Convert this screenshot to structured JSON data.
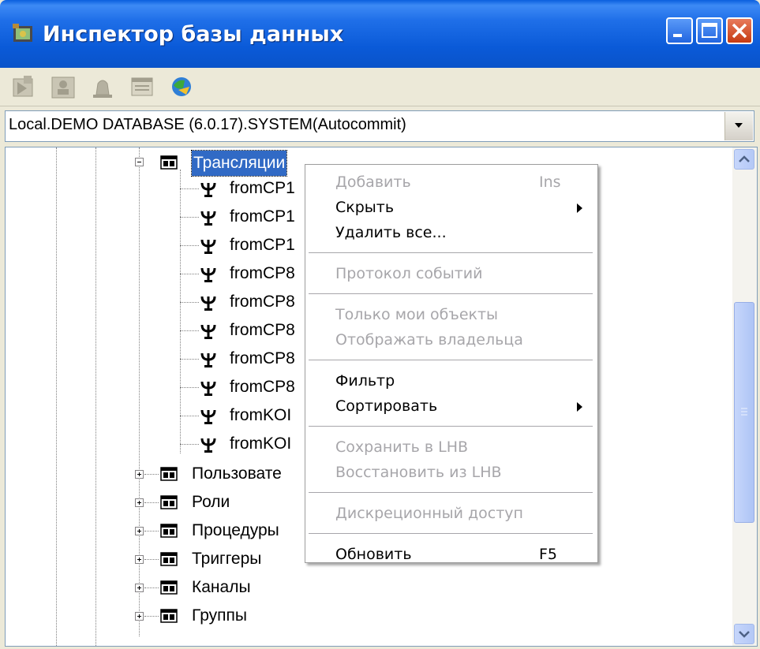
{
  "window": {
    "title": "Инспектор базы данных",
    "icon": "db-inspector-app-icon",
    "colors": {
      "titlebar": "#0a5ad8",
      "selection": "#316ac5",
      "disabled_text": "#a7a6aa"
    }
  },
  "toolbar": {
    "buttons": [
      {
        "icon": "new-object-icon"
      },
      {
        "icon": "user-properties-icon"
      },
      {
        "icon": "bell-icon"
      },
      {
        "icon": "window-list-icon"
      },
      {
        "icon": "refresh-globe-icon"
      }
    ]
  },
  "connection": {
    "selected": "Local.DEMO DATABASE (6.0.17).SYSTEM(Autocommit)"
  },
  "tree": {
    "parent": {
      "label": "Трансляции",
      "expanded": true
    },
    "children": [
      "fromCP1",
      "fromCP1",
      "fromCP1",
      "fromCP8",
      "fromCP8",
      "fromCP8",
      "fromCP8",
      "fromCP8",
      "fromKOI",
      "fromKOI"
    ],
    "siblings": [
      "Пользовате",
      "Роли",
      "Процедуры",
      "Триггеры",
      "Каналы",
      "Группы"
    ]
  },
  "context_menu": {
    "items": [
      {
        "label": "Добавить",
        "shortcut": "Ins",
        "disabled": true
      },
      {
        "label": "Скрыть",
        "submenu": true,
        "disabled": false
      },
      {
        "label": "Удалить все...",
        "disabled": false
      },
      {
        "separator": true
      },
      {
        "label": "Протокол событий",
        "disabled": true
      },
      {
        "separator": true
      },
      {
        "label": "Только мои объекты",
        "disabled": true
      },
      {
        "label": "Отображать владельца",
        "disabled": true
      },
      {
        "separator": true
      },
      {
        "label": "Фильтр",
        "disabled": false
      },
      {
        "label": "Сортировать",
        "submenu": true,
        "disabled": false
      },
      {
        "separator": true
      },
      {
        "label": "Сохранить в LHB",
        "disabled": true
      },
      {
        "label": "Восстановить из LHB",
        "disabled": true
      },
      {
        "separator": true
      },
      {
        "label": "Дискреционный доступ",
        "disabled": true
      },
      {
        "separator": true
      },
      {
        "label": "Обновить",
        "shortcut": "F5",
        "disabled": false
      }
    ]
  }
}
